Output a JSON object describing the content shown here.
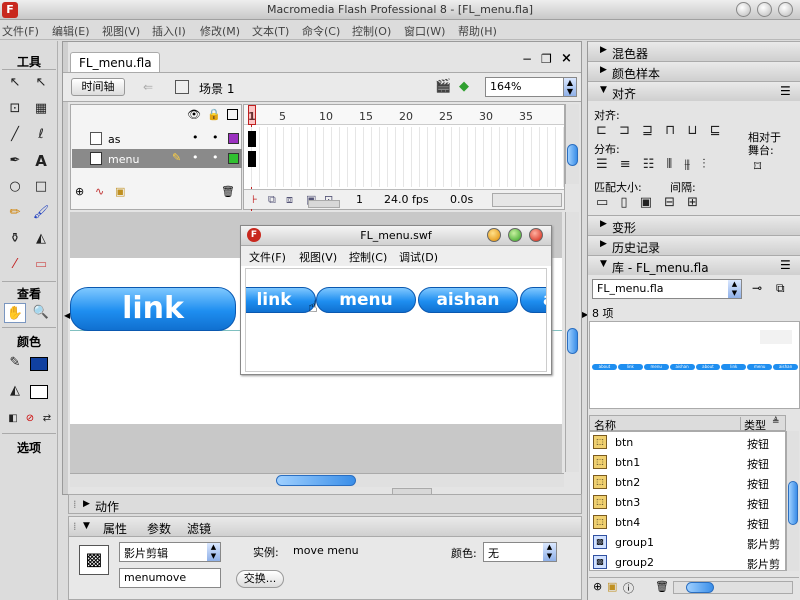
{
  "window": {
    "title": "Macromedia Flash Professional 8 - [FL_menu.fla]",
    "logo": "F"
  },
  "menubar": [
    "文件(F)",
    "编辑(E)",
    "视图(V)",
    "插入(I)",
    "修改(M)",
    "文本(T)",
    "命令(C)",
    "控制(O)",
    "窗口(W)",
    "帮助(H)"
  ],
  "toolbox": {
    "title": "工具",
    "view_label": "查看",
    "color_label": "颜色",
    "options_label": "选项",
    "tools": [
      {
        "name": "arrow-tool",
        "glyph": "↖"
      },
      {
        "name": "subselect-tool",
        "glyph": "↖"
      },
      {
        "name": "free-transform-tool",
        "glyph": "⊡"
      },
      {
        "name": "fill-transform-tool",
        "glyph": "▦"
      },
      {
        "name": "line-tool",
        "glyph": "╱"
      },
      {
        "name": "lasso-tool",
        "glyph": "ℓ"
      },
      {
        "name": "pen-tool",
        "glyph": "✒"
      },
      {
        "name": "text-tool",
        "glyph": "A"
      },
      {
        "name": "oval-tool",
        "glyph": "○"
      },
      {
        "name": "rectangle-tool",
        "glyph": "□"
      },
      {
        "name": "pencil-tool",
        "glyph": "✏"
      },
      {
        "name": "brush-tool",
        "glyph": "🖌"
      },
      {
        "name": "ink-bottle-tool",
        "glyph": "⚱"
      },
      {
        "name": "paint-bucket-tool",
        "glyph": "◭"
      },
      {
        "name": "eyedropper-tool",
        "glyph": "⁄"
      },
      {
        "name": "eraser-tool",
        "glyph": "▭"
      }
    ]
  },
  "document": {
    "tab": "FL_menu.fla",
    "timeline_button": "时间轴",
    "scene": "场景 1",
    "zoom": "164%",
    "frame_numbers": [
      "1",
      "5",
      "10",
      "15",
      "20",
      "25",
      "30",
      "35"
    ],
    "layers": [
      {
        "name": "as",
        "selected": false
      },
      {
        "name": "menu",
        "selected": true
      }
    ],
    "current_frame": "1",
    "fps": "24.0 fps",
    "time": "0.0s",
    "stage_button": "link"
  },
  "swf": {
    "title": "FL_menu.swf",
    "menu": [
      "文件(F)",
      "视图(V)",
      "控制(C)",
      "调试(D)"
    ],
    "buttons": [
      "link",
      "menu",
      "aishan",
      "a"
    ]
  },
  "panels": {
    "actions": "动作",
    "props_tab": "属性",
    "params_tab": "参数",
    "filters_tab": "滤镜",
    "symbol_type": "影片剪辑",
    "instance_label": "实例:",
    "instance_value": "move menu",
    "instance_name": "menumove",
    "swap_button": "交换...",
    "color_label": "颜色:",
    "color_value": "无"
  },
  "right": {
    "mixer": "混色器",
    "swatches": "颜色样本",
    "align": "对齐",
    "align_label": "对齐:",
    "distribute_label": "分布:",
    "match_size_label": "匹配大小:",
    "spacing_label": "间隔:",
    "to_stage_line1": "相对于",
    "to_stage_line2": "舞台:",
    "transform": "变形",
    "history": "历史记录",
    "library": "库 - FL_menu.fla",
    "library_select": "FL_menu.fla",
    "item_count": "8 项",
    "preview_labels": [
      "about",
      "link",
      "menu",
      "aishan",
      "about",
      "link",
      "menu",
      "aishan"
    ],
    "col_name": "名称",
    "col_type": "类型",
    "items": [
      {
        "name": "btn",
        "type": "按钮",
        "kind": "button"
      },
      {
        "name": "btn1",
        "type": "按钮",
        "kind": "button"
      },
      {
        "name": "btn2",
        "type": "按钮",
        "kind": "button"
      },
      {
        "name": "btn3",
        "type": "按钮",
        "kind": "button"
      },
      {
        "name": "btn4",
        "type": "按钮",
        "kind": "button"
      },
      {
        "name": "group1",
        "type": "影片剪",
        "kind": "movieclip"
      },
      {
        "name": "group2",
        "type": "影片剪",
        "kind": "movieclip"
      }
    ]
  },
  "colors": {
    "accent": "#1e8ef0",
    "layer_as_color": "#9b30c0",
    "layer_menu_color": "#30c030",
    "fill_color": "#1040a0"
  }
}
